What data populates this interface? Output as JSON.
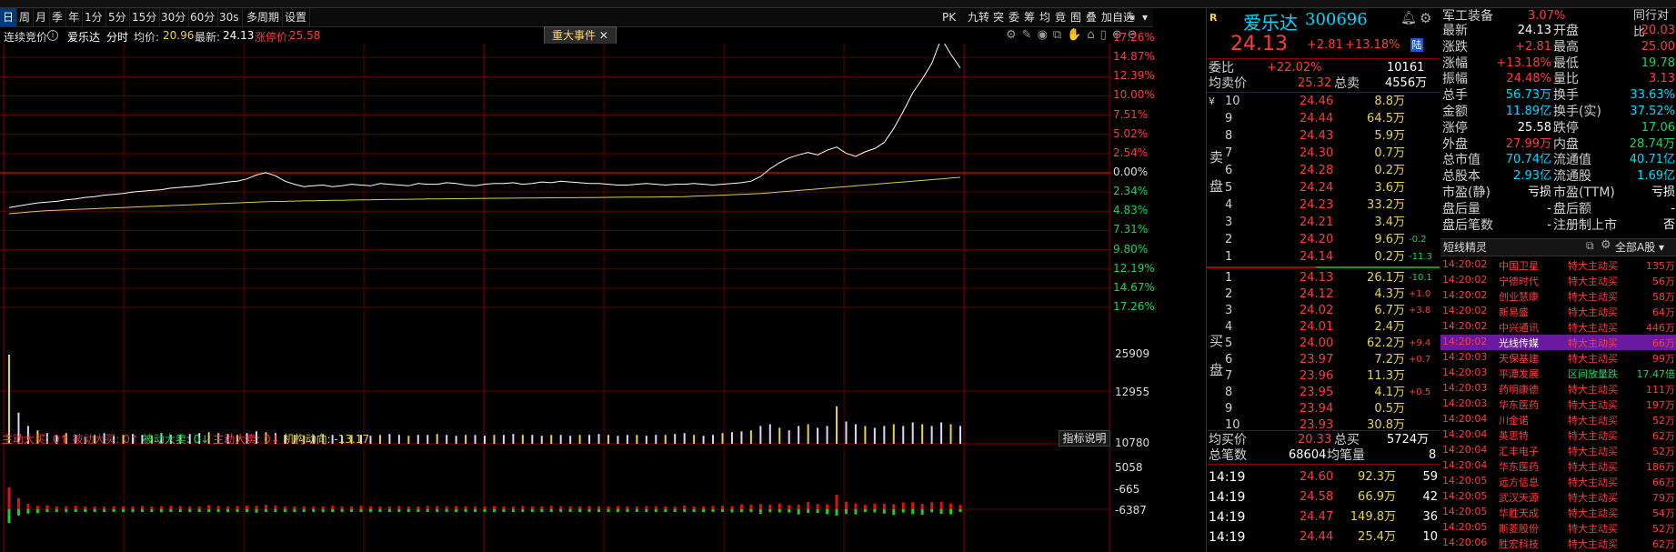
{
  "toolbar": {
    "timeframes": [
      "日",
      "周",
      "月",
      "季",
      "年",
      "1分",
      "5分",
      "15分",
      "30分",
      "60分",
      "30s",
      "多周期",
      "设置"
    ],
    "active_timeframe": "日",
    "right_buttons": [
      "PK",
      "九转",
      "突",
      "委",
      "筹",
      "均",
      "竟",
      "囿",
      "叠",
      "加自选"
    ]
  },
  "infobar": {
    "auction_label": "连续竞价",
    "stock_name": "爱乐达",
    "chart_mode": "分时",
    "avg_label": "均价:",
    "avg_value": "20.96",
    "latest_label": "最新:",
    "latest_value": "24.13",
    "limit_up_label": "涨停价:",
    "limit_up_value": "25.58",
    "event_tab": "重大事件"
  },
  "chart_data": {
    "type": "line",
    "pct_axis_top": [
      "17.26%",
      "14.87%",
      "12.39%",
      "10.00%",
      "7.51%",
      "5.02%",
      "2.54%",
      "0.00%"
    ],
    "pct_axis_bottom": [
      "2.34%",
      "4.83%",
      "7.31%",
      "9.80%",
      "12.19%",
      "14.67%",
      "17.26%"
    ],
    "volume_axis": [
      "25909",
      "12955"
    ],
    "flow_axis": [
      "10780",
      "5058",
      "-665",
      "-6387"
    ],
    "ylim_pct": [
      -17.26,
      17.26
    ],
    "price_pct": [
      -4.6,
      -4.4,
      -4.2,
      -4.0,
      -3.9,
      -3.8,
      -3.6,
      -3.5,
      -3.3,
      -3.2,
      -3.0,
      -2.9,
      -2.8,
      -2.6,
      -2.5,
      -2.4,
      -2.3,
      -2.1,
      -2.0,
      -1.9,
      -1.8,
      -1.6,
      -1.5,
      -1.3,
      -1.2,
      -0.9,
      -0.4,
      -0.1,
      -0.5,
      -1.2,
      -1.6,
      -1.9,
      -1.8,
      -1.7,
      -1.9,
      -1.8,
      -1.6,
      -1.7,
      -1.8,
      -1.5,
      -1.6,
      -1.7,
      -1.8,
      -1.5,
      -1.6,
      -1.6,
      -1.4,
      -1.5,
      -1.7,
      -1.8,
      -1.6,
      -1.5,
      -1.5,
      -1.4,
      -1.6,
      -1.5,
      -1.3,
      -1.4,
      -1.2,
      -1.3,
      -1.4,
      -1.5,
      -1.5,
      -1.6,
      -1.7,
      -1.7,
      -1.6,
      -1.5,
      -1.6,
      -1.7,
      -1.6,
      -1.6,
      -1.5,
      -1.6,
      -1.7,
      -1.6,
      -1.5,
      -1.4,
      -1.2,
      -0.6,
      0.4,
      1.2,
      1.8,
      2.2,
      2.5,
      2.2,
      2.8,
      3.2,
      2.4,
      2.0,
      2.6,
      3.0,
      3.8,
      5.6,
      7.8,
      10.2,
      12.0,
      14.0,
      17.26,
      15.2,
      13.4
    ],
    "avg_pct": [
      -5.4,
      -5.3,
      -5.2,
      -5.1,
      -5.0,
      -4.95,
      -4.9,
      -4.85,
      -4.8,
      -4.75,
      -4.7,
      -4.65,
      -4.6,
      -4.55,
      -4.5,
      -4.45,
      -4.4,
      -4.35,
      -4.3,
      -4.25,
      -4.2,
      -4.15,
      -4.1,
      -4.05,
      -4.0,
      -3.95,
      -3.9,
      -3.85,
      -3.82,
      -3.8,
      -3.77,
      -3.75,
      -3.72,
      -3.7,
      -3.68,
      -3.66,
      -3.64,
      -3.62,
      -3.6,
      -3.58,
      -3.56,
      -3.55,
      -3.53,
      -3.52,
      -3.5,
      -3.49,
      -3.47,
      -3.46,
      -3.45,
      -3.43,
      -3.42,
      -3.41,
      -3.4,
      -3.39,
      -3.38,
      -3.37,
      -3.36,
      -3.35,
      -3.34,
      -3.33,
      -3.32,
      -3.31,
      -3.3,
      -3.29,
      -3.28,
      -3.27,
      -3.26,
      -3.25,
      -3.24,
      -3.23,
      -3.22,
      -3.2,
      -3.15,
      -3.1,
      -3.05,
      -3.0,
      -2.95,
      -2.9,
      -2.85,
      -2.8,
      -2.7,
      -2.6,
      -2.5,
      -2.4,
      -2.3,
      -2.2,
      -2.1,
      -2.0,
      -1.9,
      -1.8,
      -1.7,
      -1.6,
      -1.5,
      -1.4,
      -1.3,
      -1.2,
      -1.1,
      -1.0,
      -0.9,
      -0.8,
      -0.7
    ],
    "volume": [
      1.0,
      0.35,
      0.2,
      0.15,
      0.12,
      0.1,
      0.12,
      0.1,
      0.08,
      0.1,
      0.12,
      0.09,
      0.1,
      0.11,
      0.1,
      0.09,
      0.12,
      0.1,
      0.1,
      0.11,
      0.12,
      0.13,
      0.12,
      0.11,
      0.1,
      0.12,
      0.14,
      0.13,
      0.12,
      0.1,
      0.1,
      0.09,
      0.1,
      0.11,
      0.1,
      0.09,
      0.1,
      0.1,
      0.09,
      0.1,
      0.11,
      0.1,
      0.09,
      0.1,
      0.1,
      0.11,
      0.1,
      0.09,
      0.1,
      0.1,
      0.09,
      0.1,
      0.1,
      0.11,
      0.1,
      0.1,
      0.09,
      0.1,
      0.1,
      0.09,
      0.1,
      0.1,
      0.11,
      0.1,
      0.09,
      0.1,
      0.1,
      0.09,
      0.1,
      0.1,
      0.11,
      0.12,
      0.1,
      0.09,
      0.1,
      0.12,
      0.13,
      0.14,
      0.15,
      0.2,
      0.22,
      0.18,
      0.15,
      0.2,
      0.22,
      0.18,
      0.2,
      0.42,
      0.25,
      0.22,
      0.2,
      0.18,
      0.2,
      0.22,
      0.2,
      0.24,
      0.22,
      0.2,
      0.24,
      0.22,
      0.2
    ],
    "flow_labels": {
      "main_buy": "主动大买: 0",
      "passive_buy": "被动大买: 0",
      "passive_sell": "被动大卖: 0",
      "main_sell": "主动大卖: 0",
      "institution": "机构动向: -13.17"
    },
    "indicator_button": "指标说明"
  },
  "quote": {
    "code_badge": "R",
    "name": "爱乐达",
    "code": "300696",
    "price": "24.13",
    "change": "+2.81",
    "change_pct": "+13.18%",
    "tag": "陆",
    "weibi_label": "委比",
    "weibi_value": "+22.02%",
    "weibi_diff": "10161",
    "avg_sell_label": "均卖价",
    "avg_sell_value": "25.32",
    "total_sell_label": "总卖",
    "total_sell_value": "4556万",
    "sell_side_label": "卖盘",
    "buy_side_label": "买盘",
    "asks": [
      {
        "lvl": "10",
        "price": "24.46",
        "vol": "8.8万",
        "chg": ""
      },
      {
        "lvl": "9",
        "price": "24.44",
        "vol": "64.5万",
        "chg": ""
      },
      {
        "lvl": "8",
        "price": "24.43",
        "vol": "5.9万",
        "chg": ""
      },
      {
        "lvl": "7",
        "price": "24.30",
        "vol": "0.7万",
        "chg": ""
      },
      {
        "lvl": "6",
        "price": "24.28",
        "vol": "0.2万",
        "chg": ""
      },
      {
        "lvl": "5",
        "price": "24.24",
        "vol": "3.6万",
        "chg": ""
      },
      {
        "lvl": "4",
        "price": "24.23",
        "vol": "33.2万",
        "chg": ""
      },
      {
        "lvl": "3",
        "price": "24.21",
        "vol": "3.4万",
        "chg": ""
      },
      {
        "lvl": "2",
        "price": "24.20",
        "vol": "9.6万",
        "chg": "-0.2"
      },
      {
        "lvl": "1",
        "price": "24.14",
        "vol": "0.2万",
        "chg": "-11.3"
      }
    ],
    "bids": [
      {
        "lvl": "1",
        "price": "24.13",
        "vol": "26.1万",
        "chg": "-10.1"
      },
      {
        "lvl": "2",
        "price": "24.12",
        "vol": "4.3万",
        "chg": "+1.0"
      },
      {
        "lvl": "3",
        "price": "24.02",
        "vol": "6.7万",
        "chg": "+3.8"
      },
      {
        "lvl": "4",
        "price": "24.01",
        "vol": "2.4万",
        "chg": ""
      },
      {
        "lvl": "5",
        "price": "24.00",
        "vol": "62.2万",
        "chg": "+9.4"
      },
      {
        "lvl": "6",
        "price": "23.97",
        "vol": "7.2万",
        "chg": "+0.7"
      },
      {
        "lvl": "7",
        "price": "23.96",
        "vol": "11.3万",
        "chg": ""
      },
      {
        "lvl": "8",
        "price": "23.95",
        "vol": "4.1万",
        "chg": "+0.5"
      },
      {
        "lvl": "9",
        "price": "23.94",
        "vol": "0.5万",
        "chg": ""
      },
      {
        "lvl": "10",
        "price": "23.93",
        "vol": "30.8万",
        "chg": ""
      }
    ],
    "avg_buy_label": "均买价",
    "avg_buy_value": "20.33",
    "total_buy_label": "总买",
    "total_buy_value": "5724万",
    "total_trades_label": "总笔数",
    "total_trades_value": "68604",
    "avg_trade_label": "均笔量",
    "avg_trade_value": "8",
    "ticks": [
      {
        "time": "14:19",
        "price": "24.60",
        "vol": "92.3万",
        "n": "59"
      },
      {
        "time": "14:19",
        "price": "24.58",
        "vol": "66.9万",
        "n": "42"
      },
      {
        "time": "14:19",
        "price": "24.47",
        "vol": "149.8万",
        "n": "36"
      },
      {
        "time": "14:19",
        "price": "24.44",
        "vol": "25.4万",
        "n": "10"
      }
    ]
  },
  "stats": {
    "sector_name": "军工装备",
    "sector_pct": "3.07%",
    "compare_label": "同行对比",
    "rows": [
      {
        "l1": "最新",
        "v1": "24.13",
        "l2": "开盘",
        "v2": "20.03"
      },
      {
        "l1": "涨跌",
        "v1": "+2.81",
        "l2": "最高",
        "v2": "25.00"
      },
      {
        "l1": "涨幅",
        "v1": "+13.18%",
        "l2": "最低",
        "v2": "19.78"
      },
      {
        "l1": "振幅",
        "v1": "24.48%",
        "l2": "量比",
        "v2": "3.13"
      },
      {
        "l1": "总手",
        "v1": "56.73万",
        "l2": "换手",
        "v2": "33.63%"
      },
      {
        "l1": "金额",
        "v1": "11.89亿",
        "l2": "换手(实)",
        "v2": "37.52%"
      },
      {
        "l1": "涨停",
        "v1": "25.58",
        "l2": "跌停",
        "v2": "17.06"
      },
      {
        "l1": "外盘",
        "v1": "27.99万",
        "l2": "内盘",
        "v2": "28.74万"
      },
      {
        "l1": "总市值",
        "v1": "70.74亿",
        "l2": "流通值",
        "v2": "40.71亿"
      },
      {
        "l1": "总股本",
        "v1": "2.93亿",
        "l2": "流通股",
        "v2": "1.69亿"
      },
      {
        "l1": "市盈(静)",
        "v1": "亏损",
        "l2": "市盈(TTM)",
        "v2": "亏损"
      },
      {
        "l1": "盘后量",
        "v1": "-",
        "l2": "盘后额",
        "v2": "-"
      },
      {
        "l1": "盘后笔数",
        "v1": "-",
        "l2": "注册制上市",
        "v2": "否"
      }
    ]
  },
  "flash": {
    "title": "短线精灵",
    "filter": "全部A股",
    "items": [
      {
        "time": "14:20:02",
        "name": "中国卫星",
        "type": "特大主动买",
        "val": "135万"
      },
      {
        "time": "14:20:02",
        "name": "宁德时代",
        "type": "特大主动买",
        "val": "56万"
      },
      {
        "time": "14:20:02",
        "name": "创业慧康",
        "type": "特大主动买",
        "val": "58万"
      },
      {
        "time": "14:20:02",
        "name": "新易盛",
        "type": "特大主动买",
        "val": "64万"
      },
      {
        "time": "14:20:02",
        "name": "中兴通讯",
        "type": "特大主动买",
        "val": "446万"
      },
      {
        "time": "14:20:02",
        "name": "光线传媒",
        "type": "特大主动买",
        "val": "66万"
      },
      {
        "time": "14:20:03",
        "name": "天保基建",
        "type": "特大主动买",
        "val": "99万"
      },
      {
        "time": "14:20:03",
        "name": "平潭发展",
        "type": "区间放量跌",
        "val": "17.47倍"
      },
      {
        "time": "14:20:03",
        "name": "药明康德",
        "type": "特大主动买",
        "val": "111万"
      },
      {
        "time": "14:20:03",
        "name": "华东医药",
        "type": "特大主动买",
        "val": "197万"
      },
      {
        "time": "14:20:04",
        "name": "川金诺",
        "type": "特大主动买",
        "val": "52万"
      },
      {
        "time": "14:20:04",
        "name": "英思特",
        "type": "特大主动买",
        "val": "62万"
      },
      {
        "time": "14:20:04",
        "name": "汇丰电子",
        "type": "特大主动买",
        "val": "52万"
      },
      {
        "time": "14:20:04",
        "name": "华东医药",
        "type": "特大主动买",
        "val": "186万"
      },
      {
        "time": "14:20:05",
        "name": "远方信息",
        "type": "特大主动买",
        "val": "66万"
      },
      {
        "time": "14:20:05",
        "name": "武汉天源",
        "type": "特大主动买",
        "val": "79万"
      },
      {
        "time": "14:20:05",
        "name": "华胜天成",
        "type": "特大主动买",
        "val": "54万"
      },
      {
        "time": "14:20:05",
        "name": "斯菱股份",
        "type": "特大主动买",
        "val": "52万"
      },
      {
        "time": "14:20:06",
        "name": "胜宏科技",
        "type": "特大主动买",
        "val": "62万"
      }
    ]
  }
}
